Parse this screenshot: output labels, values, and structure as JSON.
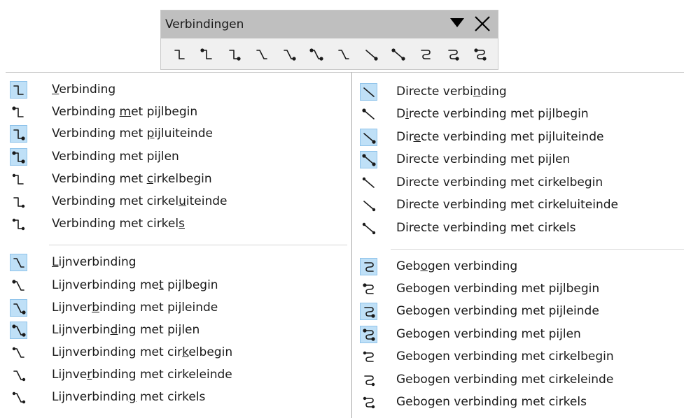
{
  "toolbar": {
    "title": "Verbindingen",
    "icons": [
      "standard-connector",
      "connector-arrow-start",
      "connector-arrow-end",
      "line-connector",
      "line-connector-arrow-end",
      "line-connector-arrows",
      "line-connector-circle",
      "straight-connector-arrow-end",
      "straight-connector-arrows",
      "curved-connector",
      "curved-connector-arrow-end",
      "curved-connector-arrows"
    ]
  },
  "left_menu": {
    "items": [
      {
        "pre": "",
        "key": "V",
        "post": "erbinding",
        "icon": "standard-connector-icon",
        "selected": true
      },
      {
        "pre": "Verbinding ",
        "key": "m",
        "post": "et pijlbegin",
        "icon": "connector-arrow-start-icon",
        "selected": false
      },
      {
        "pre": "Verbinding met ",
        "key": "p",
        "post": "ijluiteinde",
        "icon": "connector-arrow-end-icon",
        "selected": true
      },
      {
        "pre": "Verbinding met pi",
        "key": "j",
        "post": "len",
        "icon": "connector-arrows-icon",
        "selected": true
      },
      {
        "pre": "Verbinding met ",
        "key": "c",
        "post": "irkelbegin",
        "icon": "connector-circle-start-icon",
        "selected": false
      },
      {
        "pre": "Verbinding met cirkel",
        "key": "u",
        "post": "iteinde",
        "icon": "connector-circle-end-icon",
        "selected": false
      },
      {
        "pre": "Verbinding met cirkel",
        "key": "s",
        "post": "",
        "icon": "connector-circles-icon",
        "selected": false
      },
      {
        "pre": "",
        "key": "L",
        "post": "ijnverbinding",
        "icon": "line-connector-icon",
        "selected": true
      },
      {
        "pre": "Lijnverbinding me",
        "key": "t",
        "post": " pijlbegin",
        "icon": "line-connector-arrow-start-icon",
        "selected": false
      },
      {
        "pre": "Lijnver",
        "key": "b",
        "post": "inding met pijleinde",
        "icon": "line-connector-arrow-end-icon",
        "selected": true
      },
      {
        "pre": "Lijnverbin",
        "key": "d",
        "post": "ing met pijlen",
        "icon": "line-connector-arrows-icon",
        "selected": true
      },
      {
        "pre": "Lijnverbinding met cir",
        "key": "k",
        "post": "elbegin",
        "icon": "line-connector-circle-start-icon",
        "selected": false
      },
      {
        "pre": "Lijnve",
        "key": "r",
        "post": "binding met cirkeleinde",
        "icon": "line-connector-circle-end-icon",
        "selected": false
      },
      {
        "pre": "Lijnverbindin",
        "key": "g",
        "post": " met cirkels",
        "icon": "line-connector-circles-icon",
        "selected": false
      }
    ]
  },
  "right_menu": {
    "items": [
      {
        "pre": "Directe verbi",
        "key": "n",
        "post": "ding",
        "icon": "straight-connector-icon",
        "selected": true
      },
      {
        "pre": "D",
        "key": "i",
        "post": "recte verbinding met pijlbegin",
        "icon": "straight-connector-arrow-start-icon",
        "selected": false
      },
      {
        "pre": "Dir",
        "key": "e",
        "post": "cte verbinding met pijluiteinde",
        "icon": "straight-connector-arrow-end-icon",
        "selected": true
      },
      {
        "pre": "Directe verbinding met pijlen",
        "key": "",
        "post": "",
        "icon": "straight-connector-arrows-icon",
        "selected": true
      },
      {
        "pre": "Directe verbinding met cirkelbegin",
        "key": "",
        "post": "",
        "icon": "straight-connector-circle-start-icon",
        "selected": false
      },
      {
        "pre": "Directe verbinding met cirkeluiteinde",
        "key": "",
        "post": "",
        "icon": "straight-connector-circle-end-icon",
        "selected": false
      },
      {
        "pre": "Directe verbinding met cirkels",
        "key": "",
        "post": "",
        "icon": "straight-connector-circles-icon",
        "selected": false
      },
      {
        "pre": "Geb",
        "key": "o",
        "post": "gen verbinding",
        "icon": "curved-connector-icon",
        "selected": true
      },
      {
        "pre": "Gebogen verbinding met pijlbegin",
        "key": "",
        "post": "",
        "icon": "curved-connector-arrow-start-icon",
        "selected": false
      },
      {
        "pre": "Gebogen verbinding met pijleinde",
        "key": "",
        "post": "",
        "icon": "curved-connector-arrow-end-icon",
        "selected": true
      },
      {
        "pre": "Gebogen verbinding met pijlen",
        "key": "",
        "post": "",
        "icon": "curved-connector-arrows-icon",
        "selected": true
      },
      {
        "pre": "Gebogen verbinding met cirkelbegin",
        "key": "",
        "post": "",
        "icon": "curved-connector-circle-start-icon",
        "selected": false
      },
      {
        "pre": "Gebogen verbinding met cirkeleinde",
        "key": "",
        "post": "",
        "icon": "curved-connector-circle-end-icon",
        "selected": false
      },
      {
        "pre": "Gebogen verbinding met cirkels",
        "key": "",
        "post": "",
        "icon": "curved-connector-circles-icon",
        "selected": false
      }
    ]
  },
  "colors": {
    "selected_bg": "#bfe0f7",
    "toolbar_title_bg": "#bfbfbf",
    "toolbar_bg": "#f0f0f0"
  }
}
